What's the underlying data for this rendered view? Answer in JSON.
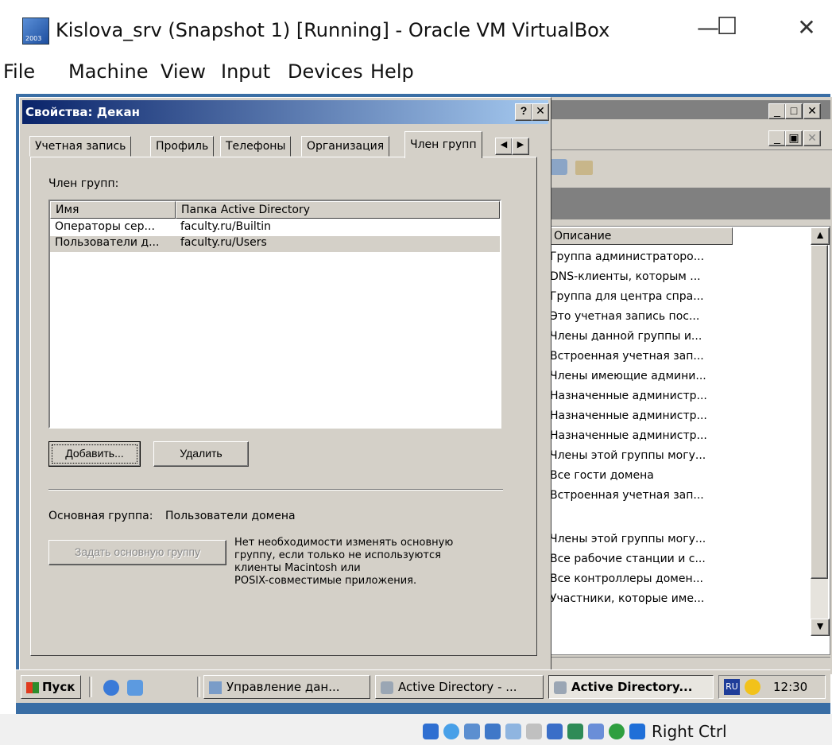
{
  "host": {
    "title": "Kislova_srv (Snapshot 1) [Running] - Oracle VM VirtualBox",
    "window_controls": {
      "minimize": "—",
      "maximize": "☐",
      "close": "✕"
    },
    "menu": [
      "File",
      "Machine",
      "View",
      "Input",
      "Devices",
      "Help"
    ],
    "status_host_key": "Right Ctrl"
  },
  "dialog": {
    "title": "Свойства: Декан",
    "help_btn": "?",
    "close_btn": "✕",
    "tabs": [
      "Учетная запись",
      "Профиль",
      "Телефоны",
      "Организация",
      "Член групп"
    ],
    "active_tab": "Член групп",
    "member_of_label": "Член групп:",
    "columns": [
      "Имя",
      "Папка Active Directory"
    ],
    "rows": [
      {
        "name": "Операторы сер...",
        "folder": "faculty.ru/Builtin"
      },
      {
        "name": "Пользователи д...",
        "folder": "faculty.ru/Users"
      }
    ],
    "add_btn": "Добавить...",
    "remove_btn": "Удалить",
    "primary_group_label": "Основная группа:",
    "primary_group_value": "Пользователи домена",
    "set_primary_btn": "Задать основную группу",
    "note_lines": [
      "Нет необходимости изменять основную",
      "группу, если только не используются",
      "клиенты Macintosh или",
      "POSIX-совместимые приложения."
    ]
  },
  "right_window": {
    "column_header": "Описание",
    "items": [
      "Группа администраторо...",
      "DNS-клиенты, которым ...",
      "Группа для центра спра...",
      "Это учетная запись пос...",
      "Члены данной группы и...",
      "Встроенная учетная зап...",
      "Члены имеющие админи...",
      "Назначенные администр...",
      "Назначенные администр...",
      "Назначенные администр...",
      "Члены этой группы могу...",
      "Все гости домена",
      "Встроенная учетная зап...",
      "",
      "Члены этой группы могу...",
      "Все рабочие станции и с...",
      "Все контроллеры домен...",
      "Участники, которые име..."
    ]
  },
  "taskbar": {
    "start": "Пуск",
    "buttons": [
      "Управление дан...",
      "Active Directory - ...",
      "Active Directory..."
    ],
    "lang": "RU",
    "clock": "12:30"
  }
}
